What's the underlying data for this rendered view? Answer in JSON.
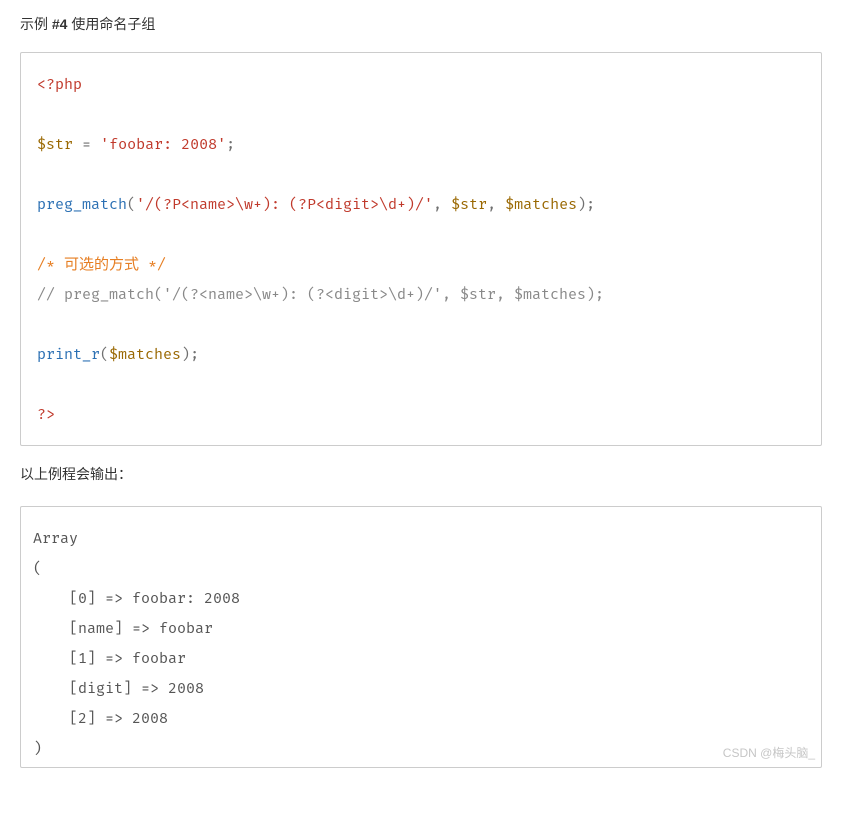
{
  "title": {
    "prefix": "示例 ",
    "bold": "#4",
    "suffix": " 使用命名子组"
  },
  "code": {
    "open_tag": "<?php",
    "var_str": "$str",
    "assign_space": " ",
    "eq": "=",
    "space": " ",
    "str_literal": "'foobar: 2008'",
    "semi": ";",
    "fn_match": "preg_match",
    "lp": "(",
    "rp": ")",
    "comma": ",",
    "ws": " ",
    "regex1": "'/(?P<name>\\w+): (?P<digit>\\d+)/'",
    "var_matches": "$matches",
    "mcomment": "/* 可选的方式 */",
    "lcomment": "// preg_match('/(?<name>\\w+): (?<digit>\\d+)/', $str, $matches);",
    "fn_printr": "print_r",
    "close_tag": "?>"
  },
  "outnote": "以上例程会输出：",
  "output": "Array\n(\n    [0] => foobar: 2008\n    [name] => foobar\n    [1] => foobar\n    [digit] => 2008\n    [2] => 2008\n)",
  "watermark": "CSDN @梅头脑_"
}
